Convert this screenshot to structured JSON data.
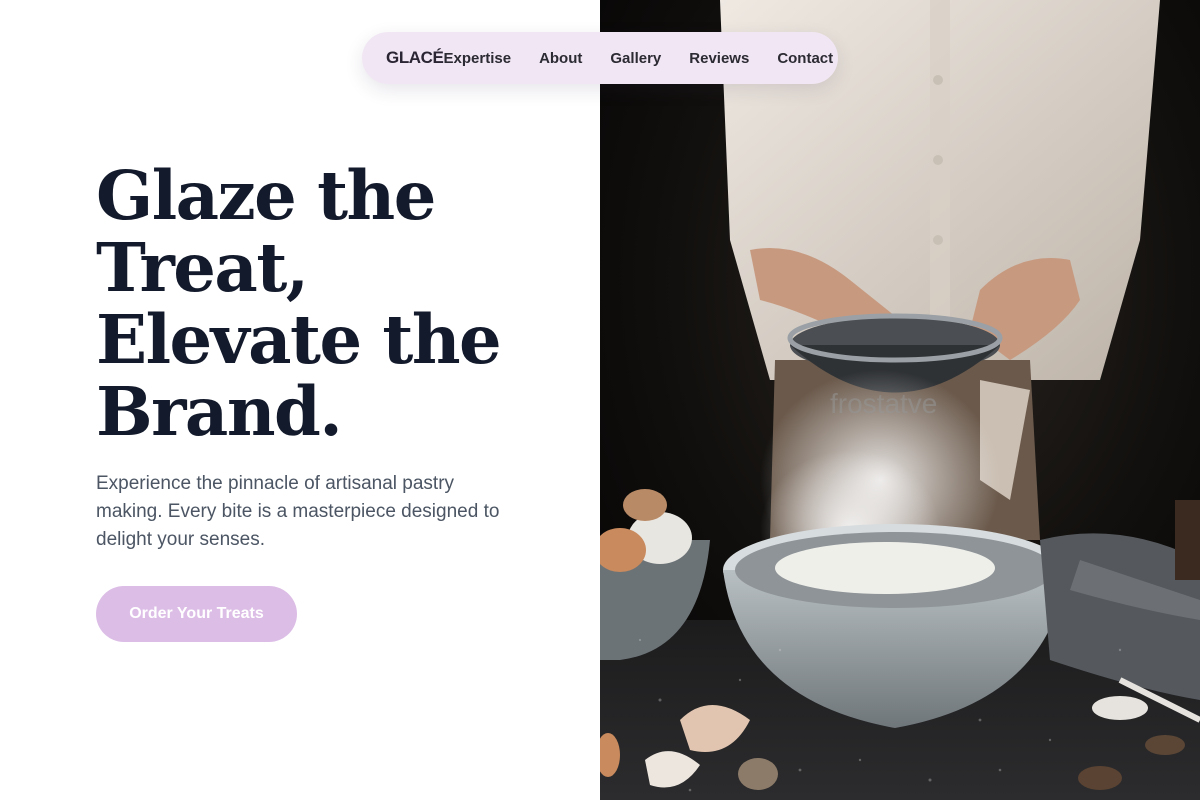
{
  "nav": {
    "brand": "GLACÉ",
    "links": [
      "Expertise",
      "About",
      "Gallery",
      "Reviews",
      "Contact"
    ]
  },
  "hero": {
    "headline_lines": [
      "Glaze the",
      "Treat,",
      "Elevate the",
      "Brand."
    ],
    "subtext": "Experience the pinnacle of artisanal pastry making. Every bite is a masterpiece designed to delight your senses.",
    "cta_label": "Order Your Treats"
  },
  "image": {
    "watermark": "frostatve"
  },
  "colors": {
    "nav_bg": "#f1e7f4",
    "headline": "#131a2b",
    "body_text": "#4b5563",
    "cta_bg": "#dcbde6",
    "photo_bg": "#0c0b0a"
  }
}
